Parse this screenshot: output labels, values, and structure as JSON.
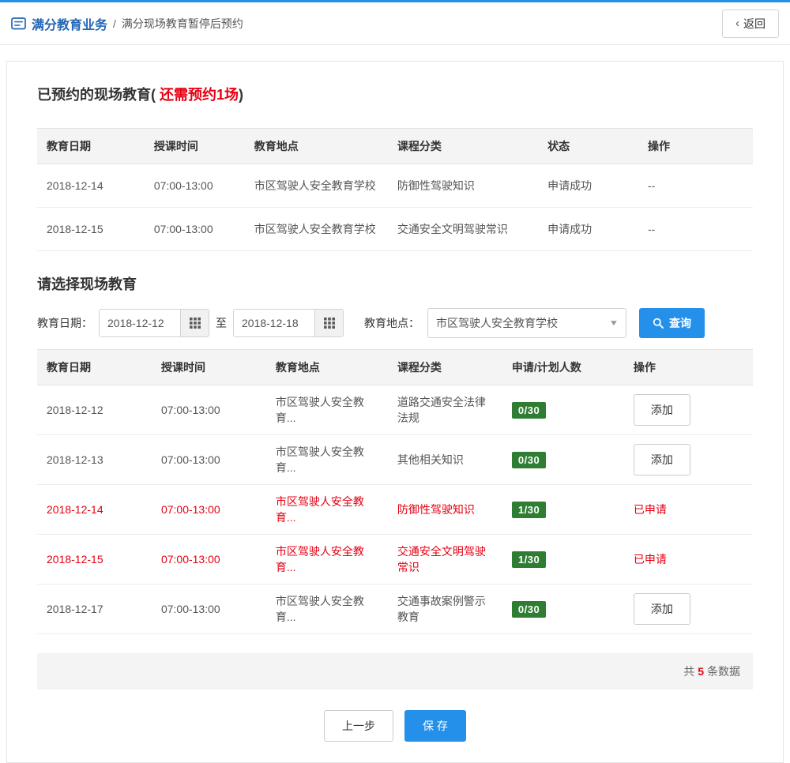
{
  "header": {
    "breadcrumb_root": "满分教育业务",
    "breadcrumb_separator": "/",
    "breadcrumb_current": "满分现场教育暂停后预约",
    "back_chevron": "‹",
    "back_button": "返回"
  },
  "icons": {
    "chevron_down": "▼"
  },
  "colors": {
    "accent_blue": "#2590e9",
    "breadcrumb_blue": "#2266b5",
    "danger_red": "#e60012",
    "badge_green": "#2e7d32"
  },
  "booked_section": {
    "title_prefix": "已预约的现场教育( ",
    "title_highlight": "还需预约1场",
    "title_suffix": ")",
    "table": {
      "headers": [
        "教育日期",
        "授课时间",
        "教育地点",
        "课程分类",
        "状态",
        "操作"
      ],
      "rows": [
        {
          "date": "2018-12-14",
          "time": "07:00-13:00",
          "location": "市区驾驶人安全教育学校",
          "category": "防御性驾驶知识",
          "status": "申请成功",
          "action": "--"
        },
        {
          "date": "2018-12-15",
          "time": "07:00-13:00",
          "location": "市区驾驶人安全教育学校",
          "category": "交通安全文明驾驶常识",
          "status": "申请成功",
          "action": "--"
        }
      ]
    }
  },
  "select_section": {
    "title": "请选择现场教育",
    "filters": {
      "date_label": "教育日期：",
      "date_from": "2018-12-12",
      "to_label": "至",
      "date_to": "2018-12-18",
      "location_label": "教育地点：",
      "location_value": "市区驾驶人安全教育学校",
      "search_button": "查询"
    },
    "table": {
      "headers": [
        "教育日期",
        "授课时间",
        "教育地点",
        "课程分类",
        "申请/计划人数",
        "操作"
      ],
      "rows": [
        {
          "date": "2018-12-12",
          "time": "07:00-13:00",
          "location": "市区驾驶人安全教育...",
          "category": "道路交通安全法律法规",
          "count": "0/30",
          "action": "添加",
          "applied": false
        },
        {
          "date": "2018-12-13",
          "time": "07:00-13:00",
          "location": "市区驾驶人安全教育...",
          "category": "其他相关知识",
          "count": "0/30",
          "action": "添加",
          "applied": false
        },
        {
          "date": "2018-12-14",
          "time": "07:00-13:00",
          "location": "市区驾驶人安全教育...",
          "category": "防御性驾驶知识",
          "count": "1/30",
          "action": "已申请",
          "applied": true
        },
        {
          "date": "2018-12-15",
          "time": "07:00-13:00",
          "location": "市区驾驶人安全教育...",
          "category": "交通安全文明驾驶常识",
          "count": "1/30",
          "action": "已申请",
          "applied": true
        },
        {
          "date": "2018-12-17",
          "time": "07:00-13:00",
          "location": "市区驾驶人安全教育...",
          "category": "交通事故案例警示教育",
          "count": "0/30",
          "action": "添加",
          "applied": false
        }
      ]
    },
    "footer": {
      "total_prefix": "共",
      "total_count": "5",
      "total_suffix": "条数据"
    }
  },
  "actions": {
    "prev_button": "上一步",
    "save_button": "保 存"
  }
}
